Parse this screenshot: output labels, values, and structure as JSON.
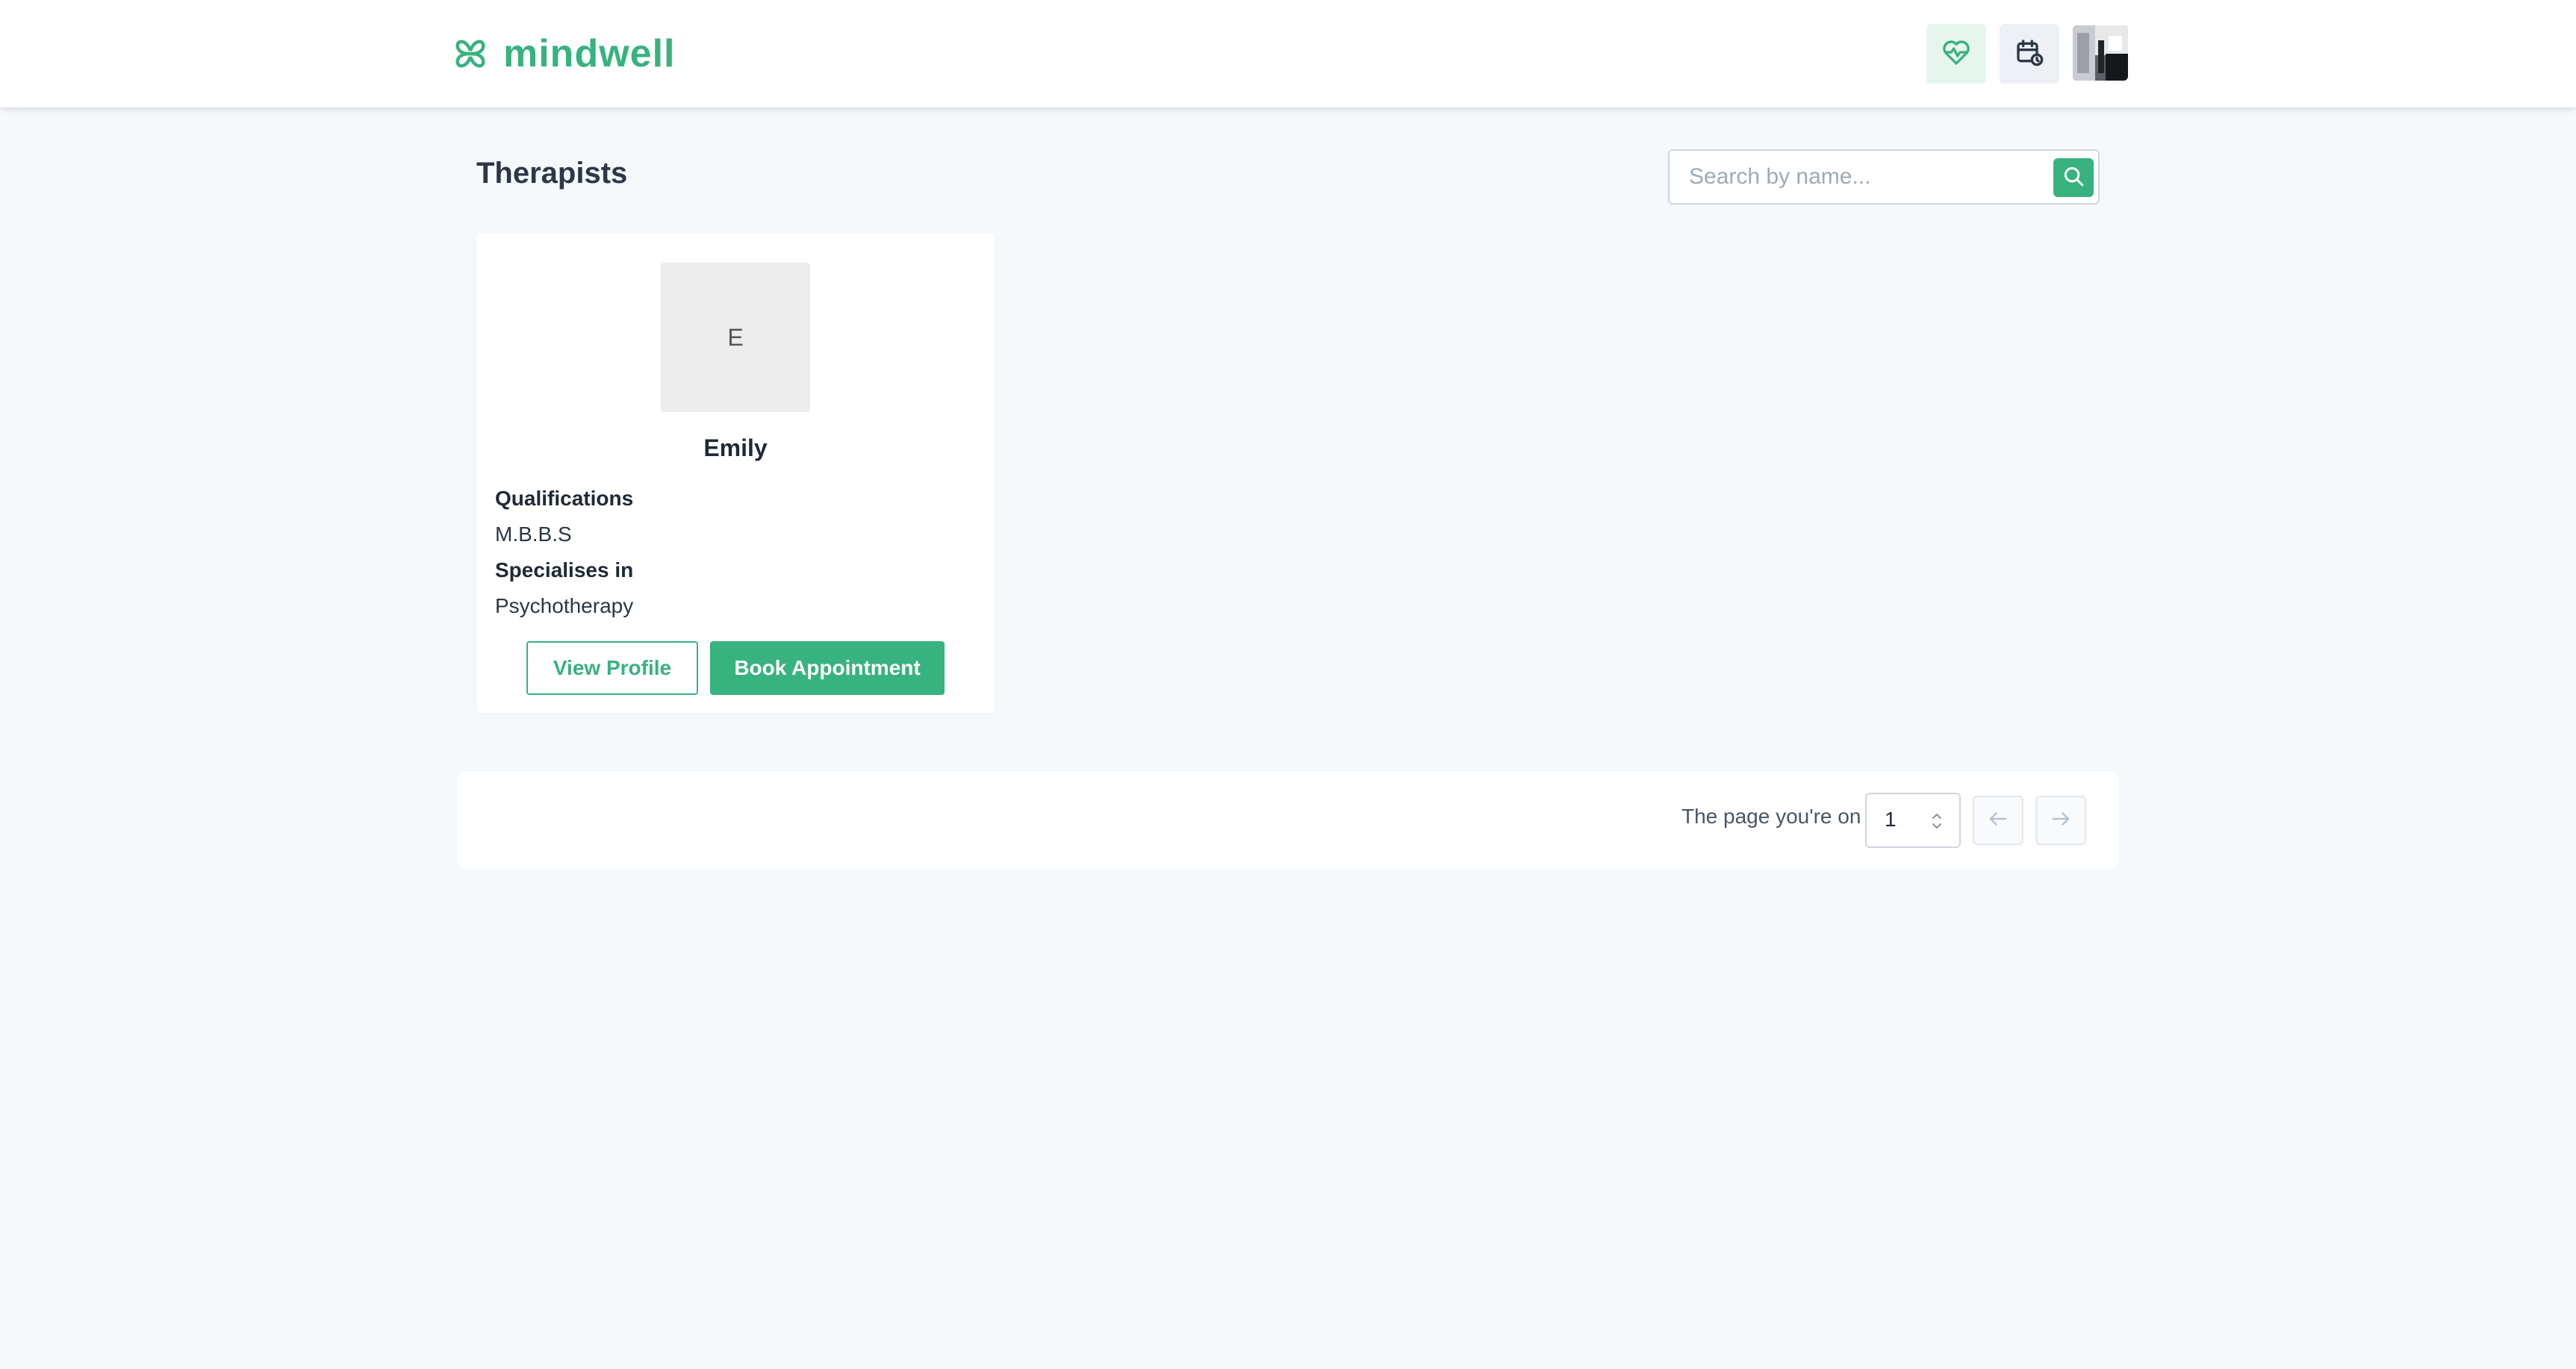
{
  "brand": {
    "name": "mindwell",
    "icon": "clover-icon",
    "color": "#38b27f"
  },
  "header": {
    "health_icon": "heart-pulse-icon",
    "calendar_icon": "calendar-clock-icon"
  },
  "page": {
    "title": "Therapists"
  },
  "search": {
    "placeholder": "Search by name...",
    "value": "",
    "icon": "search-icon"
  },
  "therapists": [
    {
      "initial": "E",
      "name": "Emily",
      "qualifications_label": "Qualifications",
      "qualifications": "M.B.B.S",
      "specialises_label": "Specialises in",
      "specialty": "Psychotherapy",
      "view_profile_label": "View Profile",
      "book_label": "Book Appointment"
    }
  ],
  "pagination": {
    "label": "The page you're on",
    "current_page": "1",
    "prev_icon": "arrow-left-icon",
    "next_icon": "arrow-right-icon"
  }
}
